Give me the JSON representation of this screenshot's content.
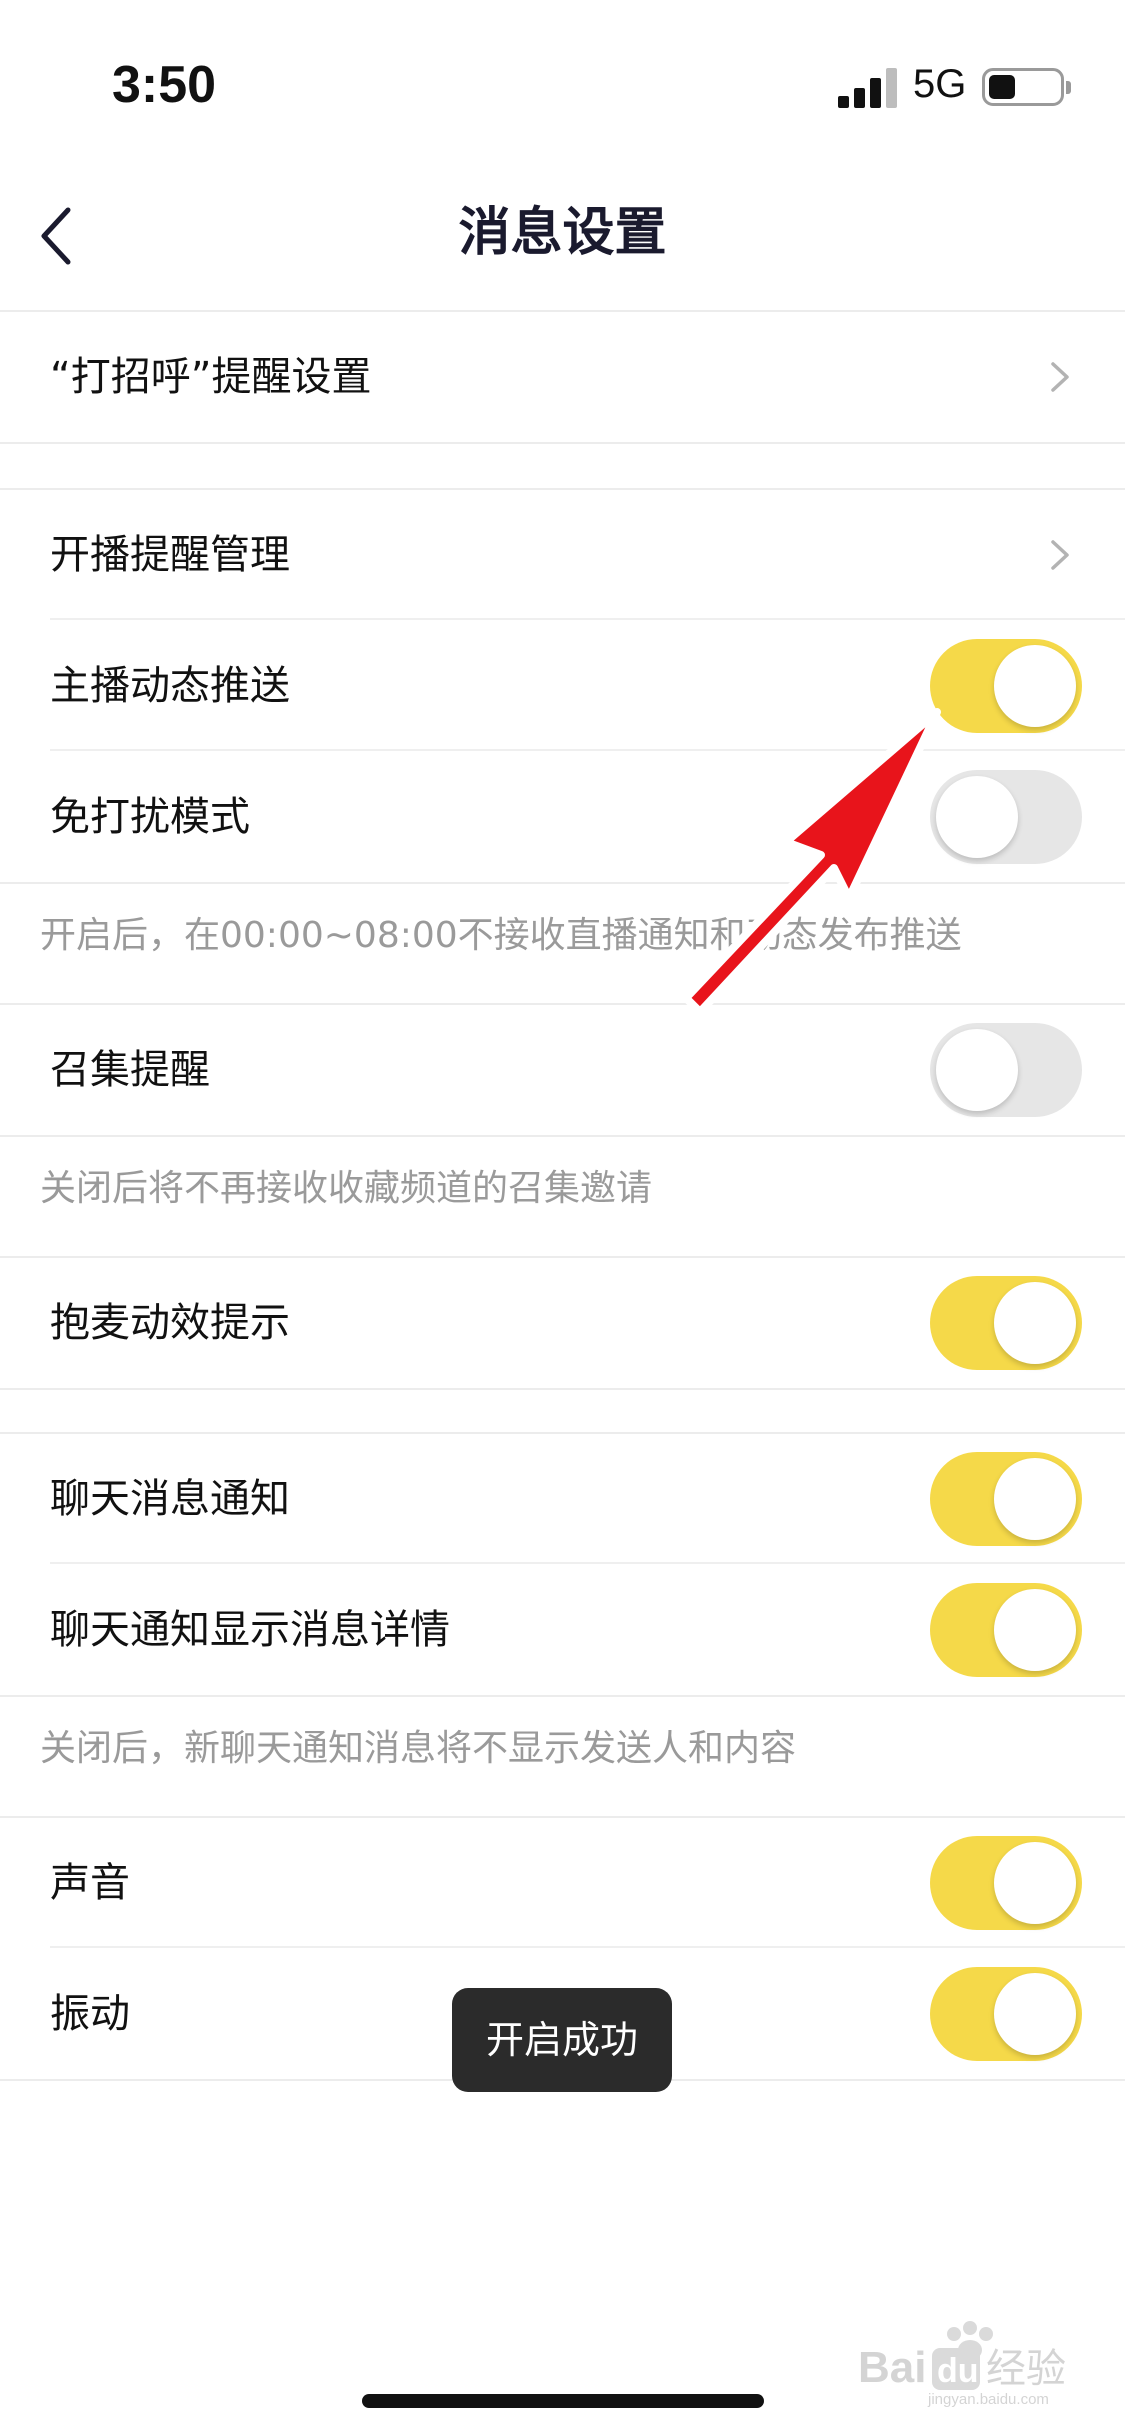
{
  "status_bar": {
    "time": "3:50",
    "network": "5G",
    "battery_level": 0.35
  },
  "nav": {
    "title": "消息设置",
    "back_icon": "chevron-left-icon"
  },
  "settings": {
    "greeting_reminder": {
      "label": "“打招呼”提醒设置"
    },
    "live_start_reminder": {
      "label": "开播提醒管理"
    },
    "streamer_feed_push": {
      "label": "主播动态推送",
      "enabled": true
    },
    "do_not_disturb": {
      "label": "免打扰模式",
      "enabled": false,
      "note": "开启后，在00:00~08:00不接收直播通知和动态发布推送"
    },
    "summon_reminder": {
      "label": "召集提醒",
      "enabled": false,
      "note": "关闭后将不再接收收藏频道的召集邀请"
    },
    "mic_effect_hint": {
      "label": "抱麦动效提示",
      "enabled": true
    },
    "chat_notification": {
      "label": "聊天消息通知",
      "enabled": true
    },
    "chat_detail": {
      "label": "聊天通知显示消息详情",
      "enabled": true,
      "note": "关闭后，新聊天通知消息将不显示发送人和内容"
    },
    "sound": {
      "label": "声音",
      "enabled": true
    },
    "vibration": {
      "label": "振动",
      "enabled": true
    }
  },
  "toast": {
    "text": "开启成功"
  },
  "colors": {
    "toggle_on": "#f5d949",
    "toggle_off": "#e6e6e6",
    "annotation_arrow": "#e8141b"
  },
  "watermark": {
    "text": "Baidu经验",
    "sub": "jingyan.baidu.com"
  }
}
